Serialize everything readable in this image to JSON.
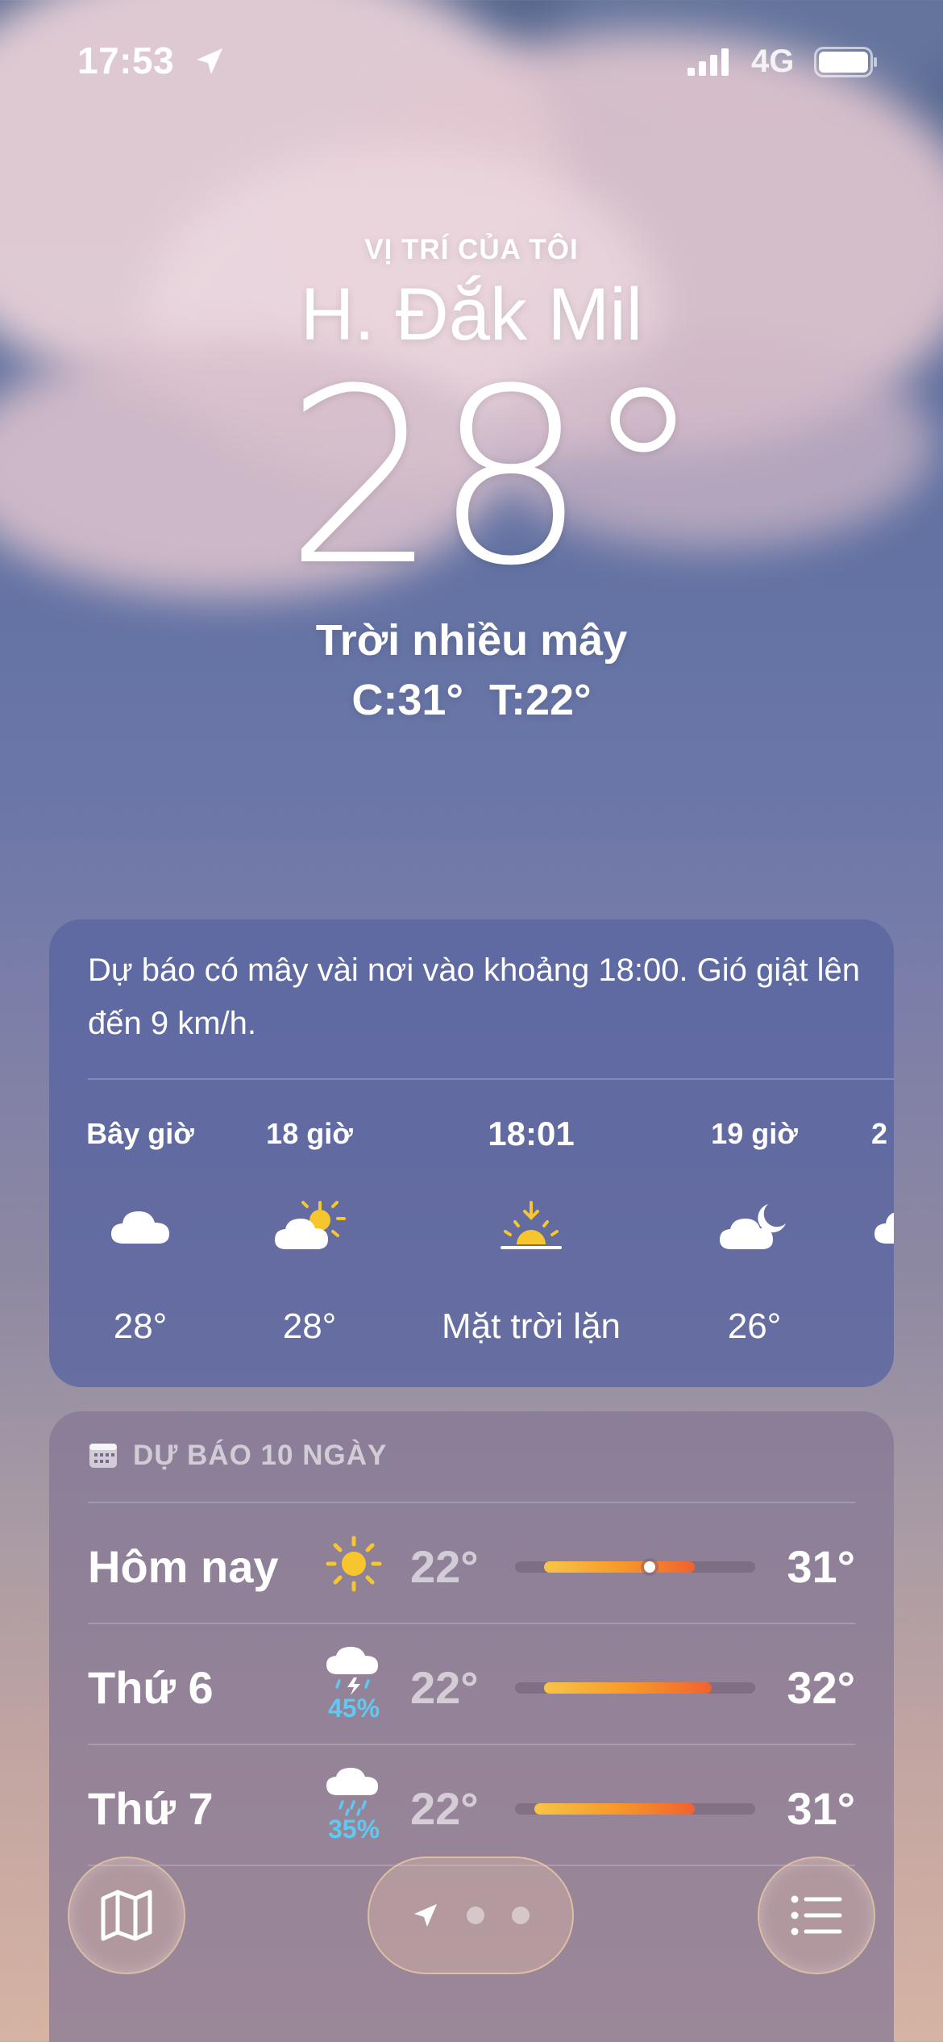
{
  "status_bar": {
    "time": "17:53",
    "network": "4G"
  },
  "location": {
    "label": "VỊ TRÍ CỦA TÔI",
    "city": "H. Đắk Mil",
    "temperature": "28°",
    "condition": "Trời nhiều mây",
    "high": "C:31°",
    "low": "T:22°"
  },
  "hourly": {
    "summary": "Dự báo có mây vài nơi vào khoảng 18:00. Gió giật lên đến 9 km/h.",
    "items": [
      {
        "label": "Bây giờ",
        "icon": "cloud-icon",
        "value": "28°"
      },
      {
        "label": "18 giờ",
        "icon": "partly-sunny-icon",
        "value": "28°"
      },
      {
        "label": "18:01",
        "icon": "sunset-icon",
        "value": "Mặt trời lặn"
      },
      {
        "label": "19 giờ",
        "icon": "cloud-moon-icon",
        "value": "26°"
      },
      {
        "label": "2",
        "icon": "cloud-icon",
        "value": ""
      }
    ]
  },
  "daily": {
    "title": "DỰ BÁO 10 NGÀY",
    "rows": [
      {
        "day": "Hôm nay",
        "icon": "sun-icon",
        "pop": "",
        "low": "22°",
        "high": "31°",
        "bar_start": 0.12,
        "bar_end": 0.75,
        "current": 0.56
      },
      {
        "day": "Thứ 6",
        "icon": "thunder-rain-icon",
        "pop": "45%",
        "low": "22°",
        "high": "32°",
        "bar_start": 0.12,
        "bar_end": 0.82,
        "current": null
      },
      {
        "day": "Thứ 7",
        "icon": "rain-icon",
        "pop": "35%",
        "low": "22°",
        "high": "31°",
        "bar_start": 0.08,
        "bar_end": 0.75,
        "current": null
      }
    ]
  },
  "colors": {
    "accent_rain": "#5ecaf2",
    "sun": "#f7c62f"
  }
}
